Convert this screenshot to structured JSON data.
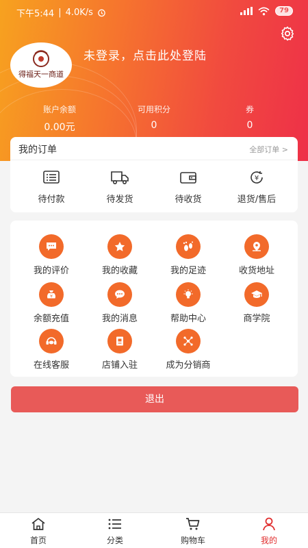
{
  "status_bar": {
    "time": "下午5:44",
    "speed": "4.0K/s",
    "battery": "79"
  },
  "profile": {
    "login_prompt": "未登录，点击此处登陆",
    "logo_text": "得福天一商道"
  },
  "stats": [
    {
      "label": "账户余额",
      "value": "0.00元"
    },
    {
      "label": "可用积分",
      "value": "0"
    },
    {
      "label": "券",
      "value": "0"
    }
  ],
  "orders": {
    "title": "我的订单",
    "all_label": "全部订单 >",
    "items": [
      {
        "label": "待付款",
        "icon": "invoice-icon"
      },
      {
        "label": "待发货",
        "icon": "truck-icon"
      },
      {
        "label": "待收货",
        "icon": "wallet-icon"
      },
      {
        "label": "退货/售后",
        "icon": "refund-icon"
      }
    ]
  },
  "services": [
    {
      "label": "我的评价",
      "icon": "comment-icon"
    },
    {
      "label": "我的收藏",
      "icon": "star-icon"
    },
    {
      "label": "我的足迹",
      "icon": "footprint-icon"
    },
    {
      "label": "收货地址",
      "icon": "location-icon"
    },
    {
      "label": "余额充值",
      "icon": "money-bag-icon"
    },
    {
      "label": "我的消息",
      "icon": "message-icon"
    },
    {
      "label": "帮助中心",
      "icon": "bulb-icon"
    },
    {
      "label": "商学院",
      "icon": "graduation-cap-icon"
    },
    {
      "label": "在线客服",
      "icon": "headset-icon"
    },
    {
      "label": "店铺入驻",
      "icon": "store-doc-icon"
    },
    {
      "label": "成为分销商",
      "icon": "share-icon"
    }
  ],
  "logout_label": "退出",
  "tabs": [
    {
      "label": "首页",
      "icon": "home-icon"
    },
    {
      "label": "分类",
      "icon": "list-icon"
    },
    {
      "label": "购物车",
      "icon": "cart-icon"
    },
    {
      "label": "我的",
      "icon": "user-icon"
    }
  ],
  "colors": {
    "accent": "#e02e2e",
    "icon_bg": "#f26a2a",
    "logout": "#e85a58"
  }
}
